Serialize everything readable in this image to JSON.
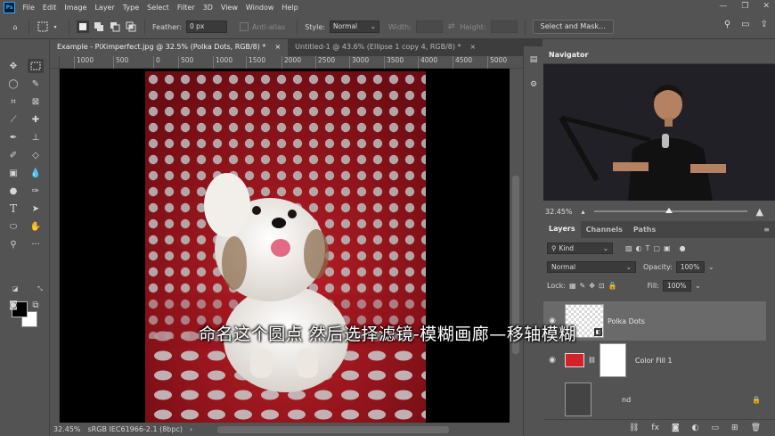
{
  "app": {
    "logo": "Ps"
  },
  "menu": [
    "File",
    "Edit",
    "Image",
    "Layer",
    "Type",
    "Select",
    "Filter",
    "3D",
    "View",
    "Window",
    "Help"
  ],
  "window_controls": [
    "—",
    "❐",
    "✕"
  ],
  "options": {
    "feather_label": "Feather:",
    "feather_value": "0 px",
    "antialias_label": "Anti-alias",
    "style_label": "Style:",
    "style_value": "Normal",
    "width_label": "Width:",
    "height_label": "Height:",
    "select_mask_label": "Select and Mask..."
  },
  "tabs": [
    {
      "label": "Example - PiXimperfect.jpg @ 32.5% (Polka Dots, RGB/8) *",
      "close": "×",
      "active": true
    },
    {
      "label": "Untitled-1 @ 43.6% (Ellipse 1 copy 4, RGB/8) *",
      "close": "×",
      "active": false
    }
  ],
  "ruler_h": [
    "1000",
    "500",
    "0",
    "500",
    "1000",
    "1500",
    "2000",
    "2500",
    "3000",
    "3500",
    "4000",
    "4500",
    "5000"
  ],
  "status": {
    "zoom": "32.45%",
    "profile": "sRGB IEC61966-2.1 (8bpc)"
  },
  "subtitle": "命名这个圆点  然后选择滤镜-模糊画廊—移轴模糊",
  "navigator": {
    "title": "Navigator",
    "zoom": "32.45%"
  },
  "layers_panel": {
    "tabs": [
      "Layers",
      "Channels",
      "Paths"
    ],
    "filter_kind": "Kind",
    "blend_mode": "Normal",
    "opacity_label": "Opacity:",
    "opacity_value": "100%",
    "lock_label": "Lock:",
    "fill_label": "Fill:",
    "fill_value": "100%",
    "layers": [
      {
        "name": "Polka Dots",
        "selected": true
      },
      {
        "name": "Color Fill 1",
        "selected": false
      }
    ],
    "partial_layer_name": "nd"
  },
  "colors": {
    "accent": "#31a8ff",
    "backdrop": "#a31620",
    "fill_swatch": "#d4222a"
  }
}
